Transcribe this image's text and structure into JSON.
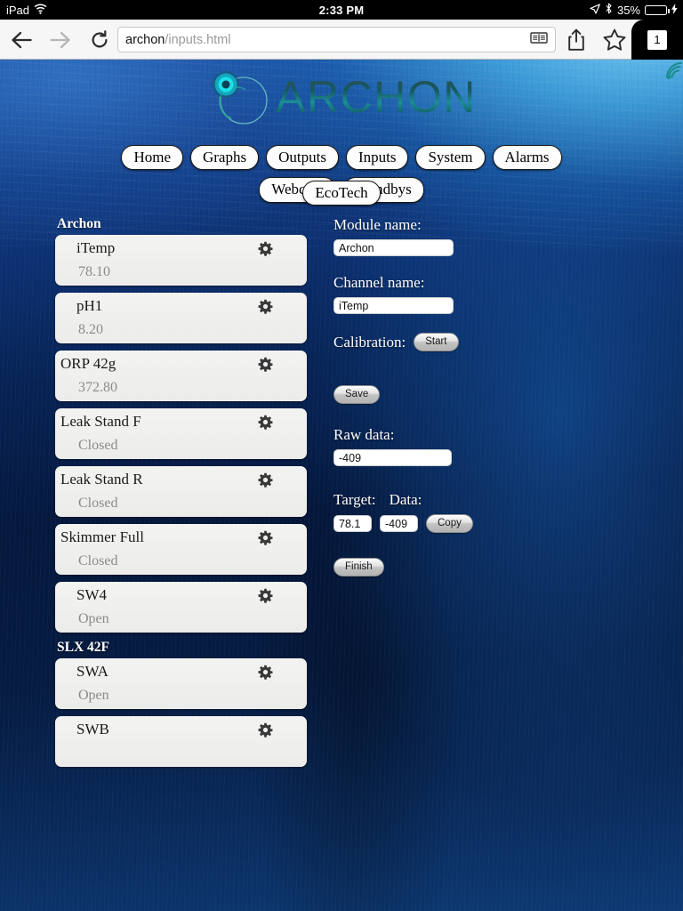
{
  "status_bar": {
    "device": "iPad",
    "wifi_icon": "wifi-icon",
    "time": "2:33 PM",
    "location_icon": "location-arrow-icon",
    "bluetooth_icon": "bluetooth-icon",
    "battery_percent": "35%",
    "battery_level": 35,
    "battery_color": "#4cd964",
    "charging_icon": "lightning-bolt-icon"
  },
  "browser": {
    "back_icon": "back-arrow-icon",
    "forward_icon": "forward-arrow-icon",
    "reload_icon": "reload-icon",
    "url_host": "archon",
    "url_path": "/inputs.html",
    "reader_icon": "reader-view-icon",
    "share_icon": "share-icon",
    "bookmark_icon": "bookmark-star-icon",
    "tab_count": "1"
  },
  "site": {
    "logo_text": "ARCHON",
    "logo_mark_icon": "archon-spiral-icon",
    "logo_signal_icon": "wifi-signal-icon",
    "accent_color": "#1b8f96",
    "background_color": "#0a2b5c"
  },
  "nav": {
    "row1": [
      {
        "label": "Home"
      },
      {
        "label": "Graphs"
      },
      {
        "label": "Outputs"
      },
      {
        "label": "Inputs"
      },
      {
        "label": "System"
      },
      {
        "label": "Alarms"
      },
      {
        "label": "Webcam"
      },
      {
        "label": "Standbys"
      }
    ],
    "row2": [
      {
        "label": "EcoTech"
      }
    ]
  },
  "channel_list": {
    "groups": [
      {
        "header": "Archon",
        "items": [
          {
            "name": "iTemp",
            "value": "78.10",
            "indent": true,
            "gear_icon": "gear-icon"
          },
          {
            "name": "pH1",
            "value": "8.20",
            "indent": true,
            "gear_icon": "gear-icon"
          },
          {
            "name": "ORP 42g",
            "value": "372.80",
            "indent": false,
            "gear_icon": "gear-icon"
          },
          {
            "name": "Leak Stand F",
            "value": "Closed",
            "indent": false,
            "gear_icon": "gear-icon"
          },
          {
            "name": "Leak Stand R",
            "value": "Closed",
            "indent": false,
            "gear_icon": "gear-icon"
          },
          {
            "name": "Skimmer Full",
            "value": "Closed",
            "indent": false,
            "gear_icon": "gear-icon"
          },
          {
            "name": "SW4",
            "value": "Open",
            "indent": true,
            "gear_icon": "gear-icon"
          }
        ]
      },
      {
        "header": "SLX 42F",
        "items": [
          {
            "name": "SWA",
            "value": "Open",
            "indent": true,
            "gear_icon": "gear-icon"
          },
          {
            "name": "SWB",
            "value": "",
            "indent": true,
            "gear_icon": "gear-icon"
          }
        ]
      }
    ]
  },
  "form": {
    "module_name_label": "Module name:",
    "module_name_value": "Archon",
    "channel_name_label": "Channel name:",
    "channel_name_value": "iTemp",
    "calibration_label": "Calibration:",
    "start_button": "Start",
    "save_button": "Save",
    "raw_data_label": "Raw data:",
    "raw_data_value": "-409",
    "target_label": "Target:",
    "data_label": "Data:",
    "target_value": "78.1",
    "data_value": "-409",
    "copy_button": "Copy",
    "finish_button": "Finish"
  }
}
